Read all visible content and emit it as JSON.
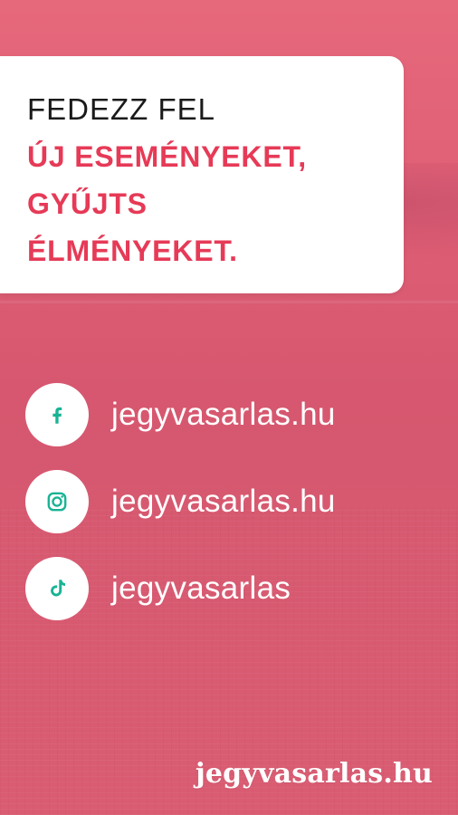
{
  "card": {
    "line1": "FEDEZZ FEL",
    "line2": "ÚJ ESEMÉNYEKET,",
    "line3": "GYŰJTS",
    "line4": "ÉLMÉNYEKET."
  },
  "social": [
    {
      "icon": "facebook-icon",
      "label": "jegyvasarlas.hu"
    },
    {
      "icon": "instagram-icon",
      "label": "jegyvasarlas.hu"
    },
    {
      "icon": "tiktok-icon",
      "label": "jegyvasarlas"
    }
  ],
  "brand": {
    "logo": "jegyvasarlas.hu"
  },
  "colors": {
    "accent": "#e63a57",
    "icon_green": "#19b394",
    "background": "#d95c72",
    "card": "#ffffff"
  }
}
